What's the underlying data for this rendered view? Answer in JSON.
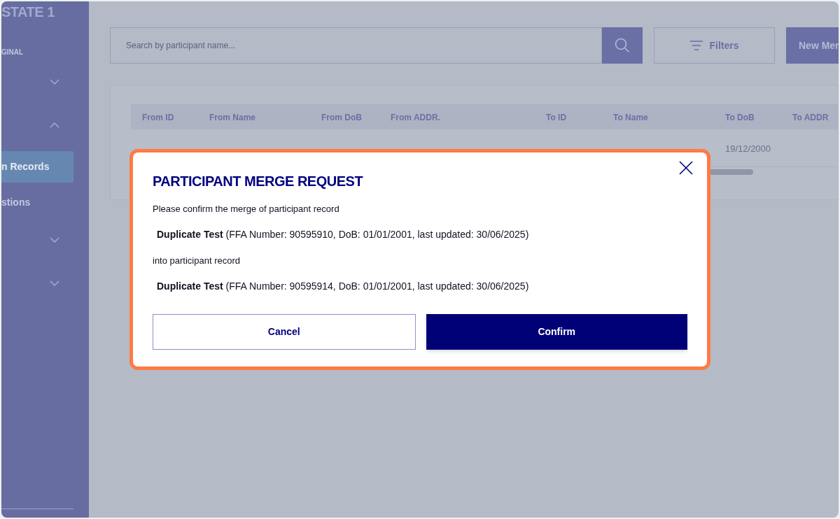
{
  "sidebar": {
    "title": "STATE 1",
    "items": [
      {
        "kind": "caption",
        "label": "GINAL"
      },
      {
        "kind": "group",
        "expanded": false
      },
      {
        "kind": "group",
        "expanded": true
      },
      {
        "kind": "link",
        "label": "n Records",
        "selected": true
      },
      {
        "kind": "link",
        "label": "stions",
        "selected": false
      },
      {
        "kind": "group",
        "expanded": false
      },
      {
        "kind": "group",
        "expanded": false
      }
    ]
  },
  "toolbar": {
    "search": {
      "placeholder": "Search by participant name..."
    },
    "filters_button": "Filters",
    "new_button": "New Mer"
  },
  "table": {
    "columns": [
      "From ID",
      "From Name",
      "From DoB",
      "From ADDR.",
      "To ID",
      "To Name",
      "To DoB",
      "To ADDR"
    ],
    "rows": [
      {
        "cells": [
          "",
          "",
          "",
          "",
          "",
          "",
          "19/12/2000",
          ""
        ]
      }
    ]
  },
  "dialog": {
    "title": "PARTICIPANT MERGE REQUEST",
    "lines": [
      {
        "kind": "text",
        "text": "Please confirm the merge of participant record"
      },
      {
        "kind": "record",
        "text": "**Duplicate Test** (FFA Number: 90595910, DoB: 01/01/2001, last updated: 30/06/2025)"
      },
      {
        "kind": "text",
        "text": "into participant record"
      },
      {
        "kind": "record",
        "text": "**Duplicate Test** (FFA Number: 90595914, DoB: 01/01/2001, last updated: 30/06/2025)"
      }
    ],
    "buttons": [
      {
        "label": "Cancel",
        "kind": "secondary"
      },
      {
        "label": "Confirm",
        "kind": "primary"
      }
    ]
  }
}
